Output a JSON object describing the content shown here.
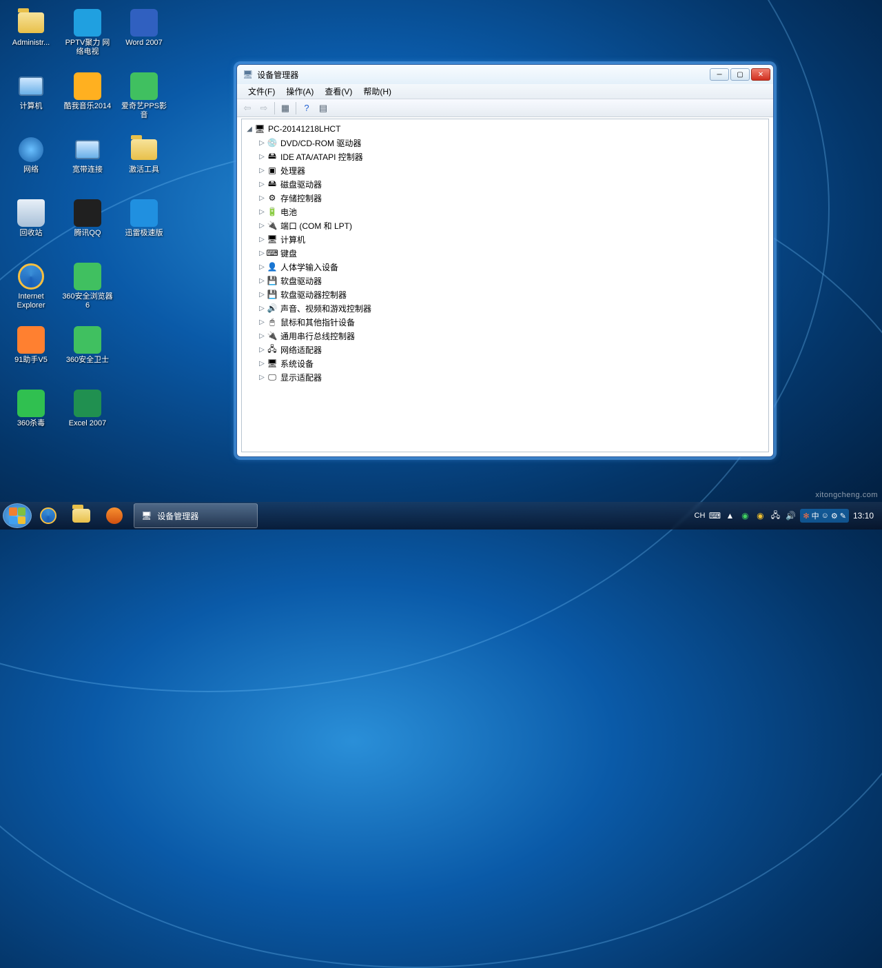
{
  "desktop": {
    "icons": [
      {
        "label": "Administr...",
        "color": "#f7e39a",
        "type": "folder"
      },
      {
        "label": "计算机",
        "color": "#a8d0f0",
        "type": "computer"
      },
      {
        "label": "网络",
        "color": "#3a8fd8",
        "type": "net"
      },
      {
        "label": "回收站",
        "color": "#d8e8f4",
        "type": "bin"
      },
      {
        "label": "Internet Explorer",
        "color": "#3a8fd8",
        "type": "ie"
      },
      {
        "label": "91助手V5",
        "color": "#ff8030",
        "type": "app"
      },
      {
        "label": "360杀毒",
        "color": "#30c050",
        "type": "app"
      },
      {
        "label": "PPTV聚力 网络电视",
        "color": "#20a0e0",
        "type": "app"
      },
      {
        "label": "酷我音乐2014",
        "color": "#ffb020",
        "type": "app"
      },
      {
        "label": "宽带连接",
        "color": "#4a8fd8",
        "type": "computer"
      },
      {
        "label": "腾讯QQ",
        "color": "#202020",
        "type": "app"
      },
      {
        "label": "360安全浏览器6",
        "color": "#40c060",
        "type": "app"
      },
      {
        "label": "360安全卫士",
        "color": "#40c060",
        "type": "app"
      },
      {
        "label": "Excel 2007",
        "color": "#209050",
        "type": "app"
      },
      {
        "label": "Word 2007",
        "color": "#3060c0",
        "type": "app"
      },
      {
        "label": "爱奇艺PPS影音",
        "color": "#40c060",
        "type": "app"
      },
      {
        "label": "激活工具",
        "color": "#f7e39a",
        "type": "folder"
      },
      {
        "label": "迅雷极速版",
        "color": "#2090e0",
        "type": "app"
      }
    ]
  },
  "window": {
    "title": "设备管理器",
    "menu": [
      "文件(F)",
      "操作(A)",
      "查看(V)",
      "帮助(H)"
    ],
    "root": "PC-20141218LHCT",
    "nodes": [
      {
        "icon": "💿",
        "label": "DVD/CD-ROM 驱动器"
      },
      {
        "icon": "🖴",
        "label": "IDE ATA/ATAPI 控制器"
      },
      {
        "icon": "▣",
        "label": "处理器"
      },
      {
        "icon": "🖴",
        "label": "磁盘驱动器"
      },
      {
        "icon": "⚙",
        "label": "存储控制器"
      },
      {
        "icon": "🔋",
        "label": "电池"
      },
      {
        "icon": "🔌",
        "label": "端口 (COM 和 LPT)"
      },
      {
        "icon": "🖥",
        "label": "计算机"
      },
      {
        "icon": "⌨",
        "label": "键盘"
      },
      {
        "icon": "👤",
        "label": "人体学输入设备"
      },
      {
        "icon": "💾",
        "label": "软盘驱动器"
      },
      {
        "icon": "💾",
        "label": "软盘驱动器控制器"
      },
      {
        "icon": "🔊",
        "label": "声音、视频和游戏控制器"
      },
      {
        "icon": "🖱",
        "label": "鼠标和其他指针设备"
      },
      {
        "icon": "🔌",
        "label": "通用串行总线控制器"
      },
      {
        "icon": "🖧",
        "label": "网络适配器"
      },
      {
        "icon": "🖥",
        "label": "系统设备"
      },
      {
        "icon": "🖵",
        "label": "显示适配器"
      }
    ]
  },
  "taskbar": {
    "active_task": "设备管理器",
    "lang": "CH",
    "lang_toggle": "中",
    "clock": "13:10"
  },
  "watermark": "xitongcheng.com"
}
